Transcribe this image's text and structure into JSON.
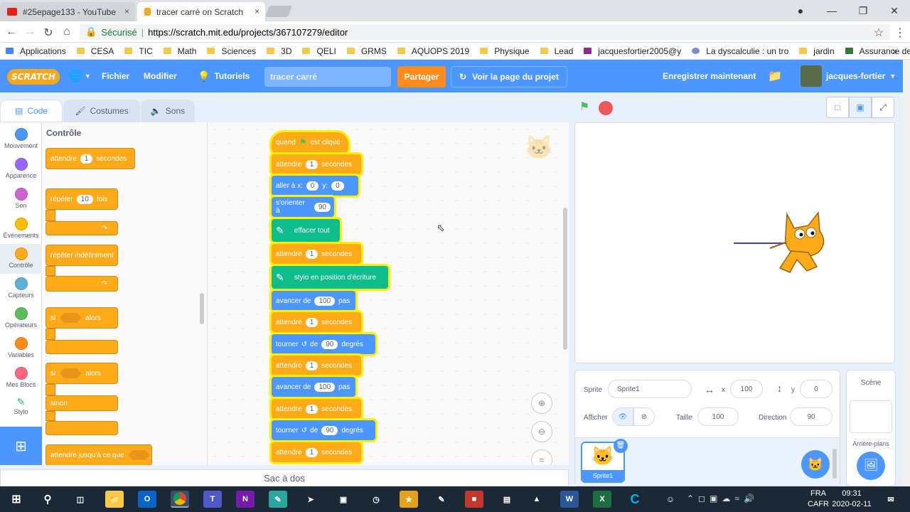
{
  "browser": {
    "tabs": [
      {
        "label": "#25epage133 - YouTube",
        "close": "×"
      },
      {
        "label": "tracer carré on Scratch",
        "close": "×"
      }
    ],
    "secure_label": "Sécurisé",
    "url": "https://scratch.mit.edu/projects/367107279/editor",
    "bookmarks": [
      "Applications",
      "CESA",
      "TIC",
      "Math",
      "Sciences",
      "3D",
      "QELI",
      "GRMS",
      "AQUOPS 2019",
      "Physique",
      "Lead",
      "jacquesfortier2005@y",
      "La dyscalculie : un tro",
      "jardin",
      "Assurance de Groupe"
    ],
    "more": "»"
  },
  "menubar": {
    "logo": "SCRATCH",
    "file": "Fichier",
    "edit": "Modifier",
    "tutorials": "Tutoriels",
    "project_title": "tracer carré",
    "share": "Partager",
    "see_project": "Voir la page du projet",
    "save_now": "Enregistrer maintenant",
    "username": "jacques-fortier"
  },
  "editor_tabs": {
    "code": "Code",
    "costumes": "Costumes",
    "sounds": "Sons"
  },
  "categories": [
    {
      "label": "Mouvement",
      "color": "#4c97ff"
    },
    {
      "label": "Apparence",
      "color": "#9966ff"
    },
    {
      "label": "Son",
      "color": "#cf63cf"
    },
    {
      "label": "Événements",
      "color": "#ffbf00"
    },
    {
      "label": "Contrôle",
      "color": "#ffab19"
    },
    {
      "label": "Capteurs",
      "color": "#5cb1d6"
    },
    {
      "label": "Opérateurs",
      "color": "#59c059"
    },
    {
      "label": "Variables",
      "color": "#ff8c1a"
    },
    {
      "label": "Mes Blocs",
      "color": "#ff6680"
    },
    {
      "label": "Stylo",
      "color": "#0fbd8c"
    }
  ],
  "palette": {
    "heading": "Contrôle",
    "wait": "attendre",
    "wait_num": "1",
    "wait_unit": "secondes",
    "repeat": "répéter",
    "repeat_num": "10",
    "repeat_unit": "fois",
    "forever": "répéter indéfiniment",
    "if": "si",
    "then": "alors",
    "if2": "si",
    "then2": "alors",
    "else": "sinon",
    "wait_until": "attendre jusqu'à ce que"
  },
  "script": {
    "hat": "quand",
    "hat_end": "est cliqué",
    "b1": "attendre",
    "b1n": "1",
    "b1u": "secondes",
    "goto": "aller à x:",
    "goto_x": "0",
    "goto_y_label": "y:",
    "goto_y": "0",
    "point": "s'orienter à",
    "point_n": "90",
    "clear": "effacer tout",
    "b2": "attendre",
    "b2n": "1",
    "b2u": "secondes",
    "pendown": "stylo en position d'écriture",
    "move1": "avancer de",
    "move1n": "100",
    "move1u": "pas",
    "b3": "attendre",
    "b3n": "1",
    "b3u": "secondes",
    "turn1": "tourner",
    "turn1_de": "de",
    "turn1n": "90",
    "turn1u": "degrés",
    "b4": "attendre",
    "b4n": "1",
    "b4u": "secondes",
    "move2": "avancer de",
    "move2n": "100",
    "move2u": "pas",
    "b5": "attendre",
    "b5n": "1",
    "b5u": "secondes",
    "turn2": "tourner",
    "turn2_de": "de",
    "turn2n": "90",
    "turn2u": "degrés",
    "b6": "attendre",
    "b6n": "1",
    "b6u": "secondes"
  },
  "zoom": {
    "reset": "="
  },
  "backpack": "Sac à dos",
  "sprite_info": {
    "sprite_label": "Sprite",
    "sprite_name": "Sprite1",
    "x_label": "x",
    "x": "100",
    "y_label": "y",
    "y": "0",
    "show_label": "Afficher",
    "size_label": "Taille",
    "size": "100",
    "direction_label": "Direction",
    "direction": "90",
    "thumb_name": "Sprite1"
  },
  "scene": {
    "label": "Scène",
    "backdrops": "Arrière-plans"
  },
  "taskbar": {
    "lang": "FRA",
    "layout": "CAFR",
    "time": "09:31",
    "date": "2020-02-11"
  }
}
